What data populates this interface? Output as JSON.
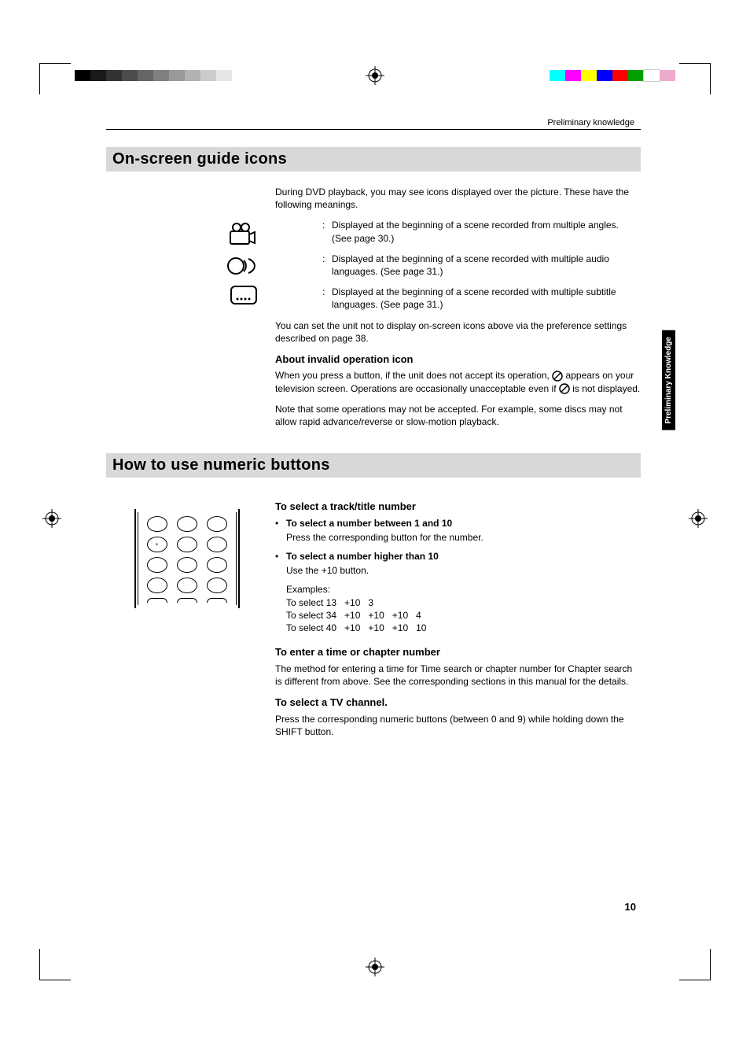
{
  "page": {
    "running_head": "Preliminary knowledge",
    "section1": "On-screen guide icons",
    "intro": "During DVD playback, you may see icons displayed over the picture.  These have the following meanings.",
    "icon_angle_desc": "Displayed at the beginning of a scene recorded from multiple angles. (See page 30.)",
    "icon_audio_desc": "Displayed at the beginning of a scene recorded with multiple audio languages.  (See page 31.)",
    "icon_subtitle_desc": "Displayed at the beginning of a scene recorded with multiple subtitle languages.  (See page 31.)",
    "pref_note": "You can set the unit not to display on-screen icons above via the preference settings described on page 38.",
    "invalid_heading": "About invalid operation icon",
    "invalid_p1a": "When you press a button, if the unit does not accept its operation, ",
    "invalid_p1b": " appears on your television screen. Operations are occasionally unacceptable even if ",
    "invalid_p1c": " is not displayed.",
    "invalid_p2": "Note that some operations may not be accepted. For example, some discs may not allow rapid advance/reverse or slow-motion playback.",
    "section2": "How to use numeric buttons",
    "sel_heading": "To select a track/title number",
    "sel_b1": "To select a number between 1 and 10",
    "sel_b1_body": "Press the corresponding button for the number.",
    "sel_b2": "To select a number higher than 10",
    "sel_b2_body": "Use the +10 button.",
    "examples_label": "Examples:",
    "ex_rows": [
      {
        "label": "To select 13",
        "c1": "+10",
        "c2": "3",
        "c3": "",
        "c4": ""
      },
      {
        "label": "To select 34",
        "c1": "+10",
        "c2": "+10",
        "c3": "+10",
        "c4": "4"
      },
      {
        "label": "To select 40",
        "c1": "+10",
        "c2": "+10",
        "c3": "+10",
        "c4": "10"
      }
    ],
    "enter_heading": "To enter a time or chapter number",
    "enter_body": "The method for entering a time for Time search or chapter number for Chapter search is different from above. See the corresponding sections in this manual for the details.",
    "tv_heading": "To select a TV channel.",
    "tv_body": "Press the corresponding numeric buttons (between 0 and 9) while holding down the SHIFT button.",
    "page_number": "10",
    "side_tab": "Preliminary\nKnowledge",
    "colors_left": [
      "#000000",
      "#1a1a1a",
      "#333333",
      "#4d4d4d",
      "#666666",
      "#808080",
      "#999999",
      "#b3b3b3",
      "#cccccc",
      "#e6e6e6"
    ],
    "colors_right": [
      "#00ffff",
      "#ff00ff",
      "#ffff00",
      "#0000ff",
      "#ff0000",
      "#00a000",
      "#ffffff",
      "#eeaacc"
    ]
  }
}
